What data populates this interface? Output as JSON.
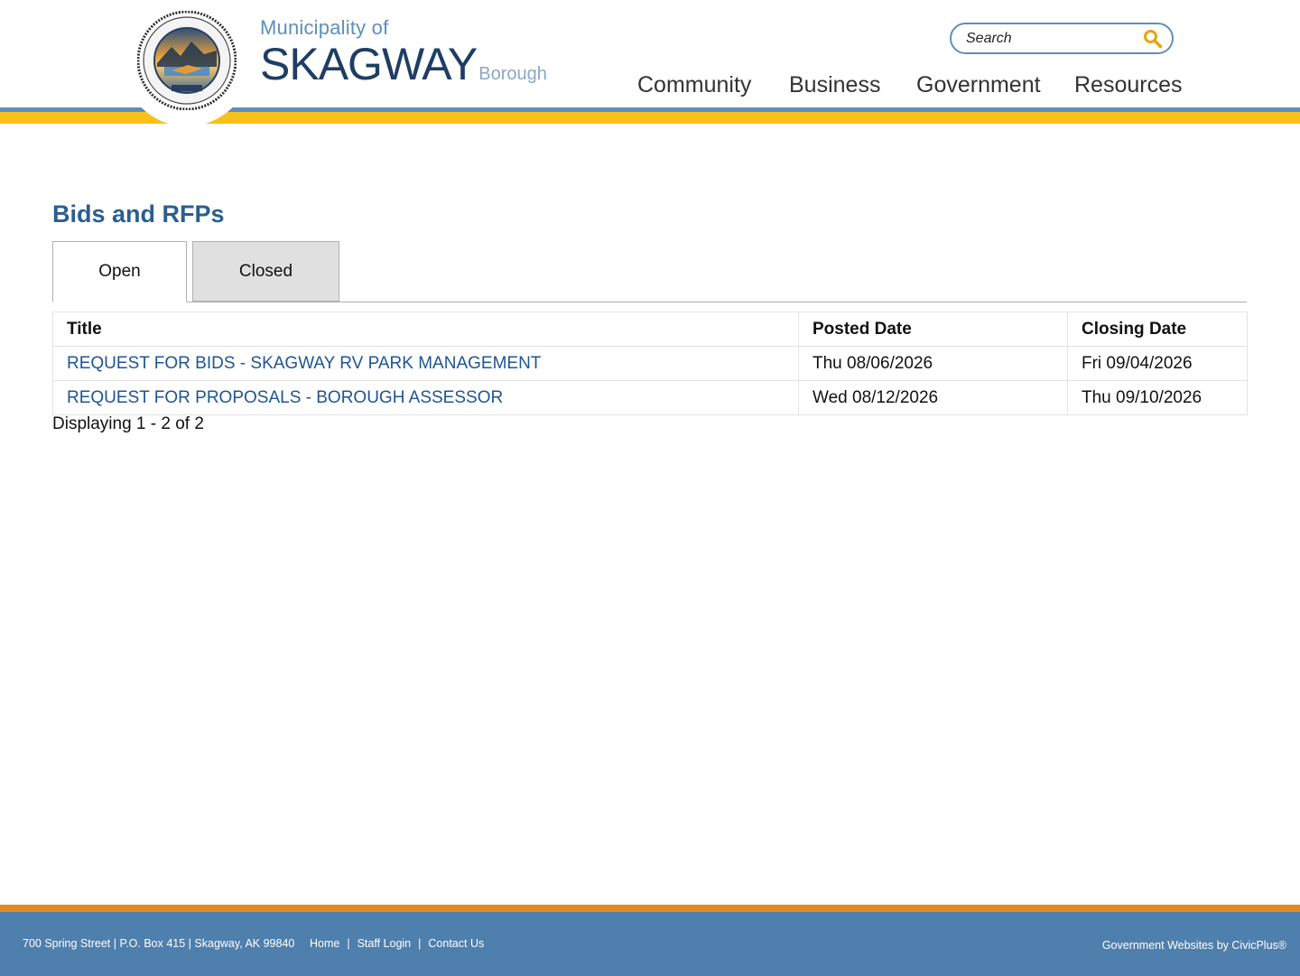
{
  "header": {
    "brand_top": "Municipality of",
    "brand_name": "SKAGWAY",
    "brand_sub": "Borough",
    "seal_text": "MUNICIPALITY OF SKAGWAY BOROUGH · GATEWAY TO THE KLONDIKE",
    "search_placeholder": "Search",
    "search_icon": "magnifier-icon",
    "nav": [
      "Community",
      "Business",
      "Government",
      "Resources"
    ]
  },
  "colors": {
    "accent_blue": "#5e8fb9",
    "gold": "#f6c11a",
    "title_blue": "#2a5f8f",
    "link_blue": "#1f5494",
    "footer_blue": "#4f7fac",
    "footer_orange": "#e48a23"
  },
  "main": {
    "title": "Bids and RFPs",
    "tabs": [
      {
        "label": "Open",
        "active": true
      },
      {
        "label": "Closed",
        "active": false
      }
    ],
    "table": {
      "headers": [
        "Title",
        "Posted Date",
        "Closing Date"
      ],
      "rows": [
        [
          "REQUEST FOR BIDS - SKAGWAY RV PARK MANAGEMENT",
          "Thu 08/06/2026",
          "Fri 09/04/2026"
        ],
        [
          "REQUEST FOR PROPOSALS - BOROUGH ASSESSOR",
          "Wed 08/12/2026",
          "Thu 09/10/2026"
        ]
      ]
    },
    "display_count": "Displaying 1 - 2 of 2"
  },
  "footer": {
    "address": "700 Spring Street | P.O. Box 415 | Skagway, AK 99840",
    "links": [
      "Home",
      "Staff Login",
      "Contact Us"
    ],
    "credit": "Government Websites by CivicPlus®"
  }
}
